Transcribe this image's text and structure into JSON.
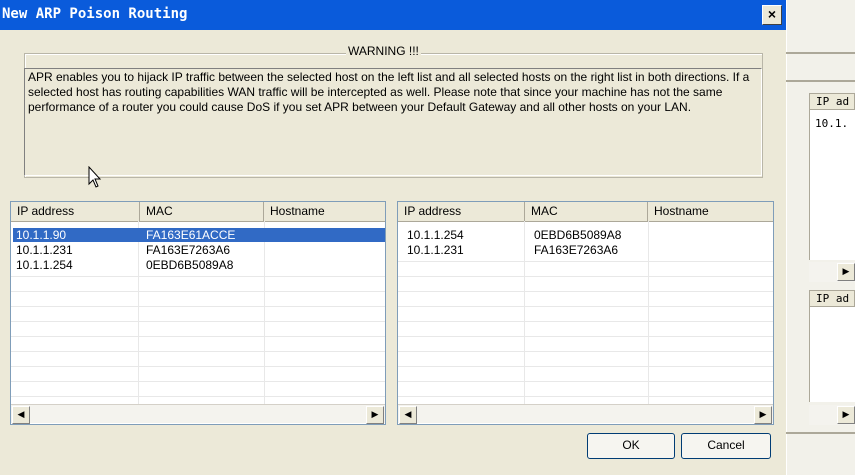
{
  "dialog": {
    "title": "New ARP Poison Routing",
    "close_glyph": "×",
    "warning_title": "WARNING !!!",
    "warning_text": "APR enables you to hijack IP traffic between the selected host on the left list and all selected hosts on the right list in both directions. If a selected host has routing capabilities WAN traffic will be intercepted as well. Please note that since your machine has not the same performance of a router you could cause DoS if you set APR between your Default Gateway and all other hosts on your LAN.",
    "ok_label": "OK",
    "cancel_label": "Cancel"
  },
  "left_list": {
    "columns": [
      "IP address",
      "MAC",
      "Hostname"
    ],
    "rows": [
      {
        "ip": "10.1.1.90",
        "mac": "FA163E61ACCE",
        "host": "",
        "selected": true
      },
      {
        "ip": "10.1.1.231",
        "mac": "FA163E7263A6",
        "host": "",
        "selected": false
      },
      {
        "ip": "10.1.1.254",
        "mac": "0EBD6B5089A8",
        "host": "",
        "selected": false
      }
    ]
  },
  "right_list": {
    "columns": [
      "IP address",
      "MAC",
      "Hostname"
    ],
    "rows": [
      {
        "ip": "10.1.1.254",
        "mac": "0EBD6B5089A8",
        "host": "",
        "selected": false
      },
      {
        "ip": "10.1.1.231",
        "mac": "FA163E7263A6",
        "host": "",
        "selected": false
      }
    ]
  },
  "background": {
    "top_header": "IP ad",
    "top_cell": "10.1.",
    "bottom_header": "IP ad"
  },
  "icons": {
    "scroll_left": "◀",
    "scroll_right": "▶"
  },
  "colors": {
    "titlebar": "#0a5bdb",
    "selection": "#316ac5",
    "dialog_face": "#ece9d8"
  }
}
